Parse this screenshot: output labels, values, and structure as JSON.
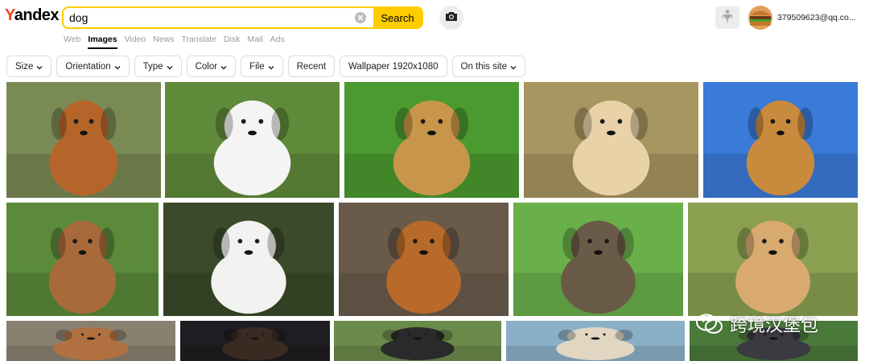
{
  "header": {
    "logo_first": "Y",
    "logo_rest": "andex",
    "search_value": "dog",
    "search_button": "Search",
    "user_email": "379509623@qq.co..."
  },
  "tabs": [
    {
      "label": "Web",
      "active": false
    },
    {
      "label": "Images",
      "active": true
    },
    {
      "label": "Video",
      "active": false
    },
    {
      "label": "News",
      "active": false
    },
    {
      "label": "Translate",
      "active": false
    },
    {
      "label": "Disk",
      "active": false
    },
    {
      "label": "Mail",
      "active": false
    },
    {
      "label": "Ads",
      "active": false
    }
  ],
  "filters": [
    {
      "label": "Size",
      "dropdown": true
    },
    {
      "label": "Orientation",
      "dropdown": true
    },
    {
      "label": "Type",
      "dropdown": true
    },
    {
      "label": "Color",
      "dropdown": true
    },
    {
      "label": "File",
      "dropdown": true
    },
    {
      "label": "Recent",
      "dropdown": false
    },
    {
      "label": "Wallpaper 1920x1080",
      "dropdown": false
    },
    {
      "label": "On this site",
      "dropdown": true
    }
  ],
  "images": [
    {
      "desc": "beagle-running",
      "bg": "#7a8a55",
      "dog": "#b5652a"
    },
    {
      "desc": "white-spitz-lying",
      "bg": "#5f8a3a",
      "dog": "#f4f4f2"
    },
    {
      "desc": "boerboel-on-lawn",
      "bg": "#4a9a30",
      "dog": "#c8964a"
    },
    {
      "desc": "golden-puppy-running",
      "bg": "#a89660",
      "dog": "#e9d2a8"
    },
    {
      "desc": "golden-retriever-sky",
      "bg": "#3a7ad8",
      "dog": "#c88a3c"
    },
    {
      "desc": "beagle-puppy-clover",
      "bg": "#5a8a3a",
      "dog": "#a86a3a"
    },
    {
      "desc": "white-maltese-grass",
      "bg": "#3a4a2a",
      "dog": "#f2f2f0"
    },
    {
      "desc": "spaniel-lying-deck",
      "bg": "#6a5a4a",
      "dog": "#b86a2a"
    },
    {
      "desc": "dog-on-grass-ears",
      "bg": "#6ab04a",
      "dog": "#6a5a48"
    },
    {
      "desc": "golden-retriever-field",
      "bg": "#8aa050",
      "dog": "#d8aa70"
    },
    {
      "desc": "hound-partial",
      "bg": "#8a8070",
      "dog": "#b07040"
    },
    {
      "desc": "dark-dog-partial",
      "bg": "#1e1e22",
      "dog": "#3a2a22"
    },
    {
      "desc": "border-collie-partial",
      "bg": "#6a8a4a",
      "dog": "#2a2a2a"
    },
    {
      "desc": "retriever-tree-partial",
      "bg": "#8ab0c8",
      "dog": "#e0d6c2"
    },
    {
      "desc": "heeler-partial",
      "bg": "#4a7a3a",
      "dog": "#3a3a40"
    }
  ],
  "watermark": {
    "text": "跨境汉堡包"
  },
  "colors": {
    "accent": "#ffcc00",
    "logo_red": "#fc3f1d"
  },
  "icons": [
    "clear-icon",
    "camera-icon",
    "notification-icon",
    "chevron-down-icon",
    "wechat-icon"
  ]
}
